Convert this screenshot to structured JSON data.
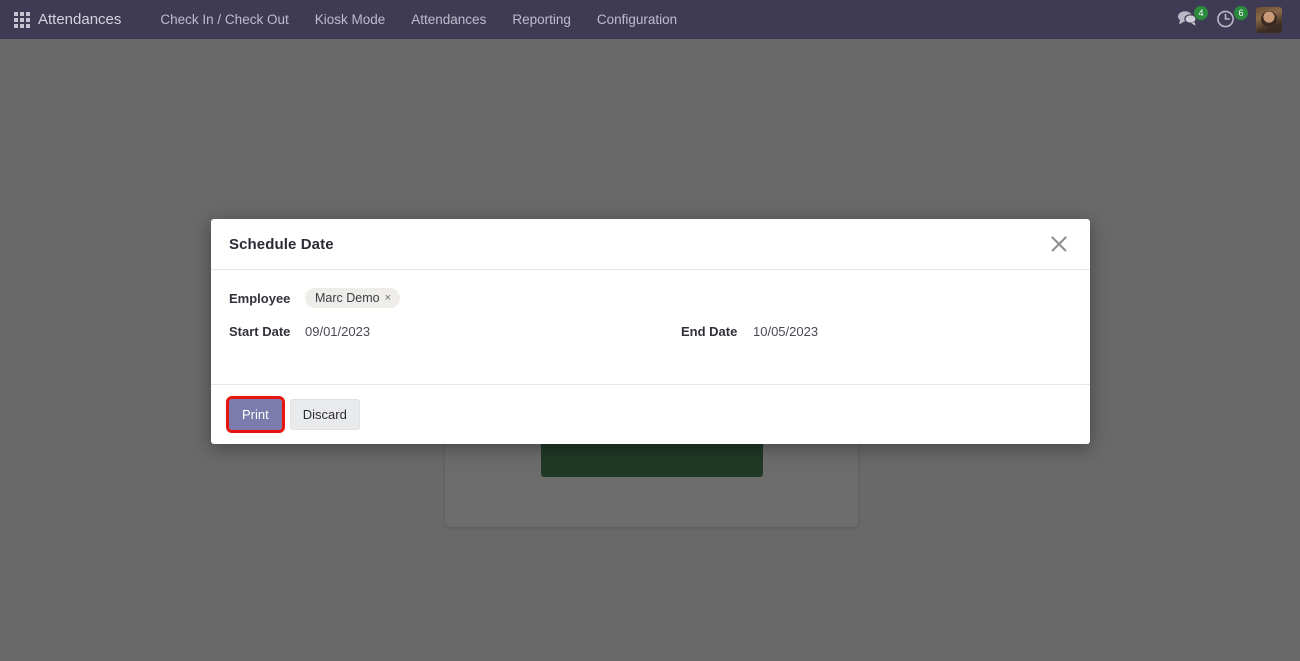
{
  "navbar": {
    "apps_icon": "apps-grid-icon",
    "brand": "Attendances",
    "menu": [
      {
        "label": "Check In / Check Out"
      },
      {
        "label": "Kiosk Mode"
      },
      {
        "label": "Attendances"
      },
      {
        "label": "Reporting"
      },
      {
        "label": "Configuration"
      }
    ],
    "messages_icon": "chat-bubble-icon",
    "messages_count": "4",
    "activities_icon": "clock-icon",
    "activities_count": "6",
    "avatar": "user-avatar"
  },
  "dialog": {
    "title": "Schedule Date",
    "close_icon": "close-icon",
    "employee": {
      "label": "Employee",
      "tag": "Marc Demo",
      "tag_remove_icon": "×"
    },
    "start_date": {
      "label": "Start Date",
      "value": "09/01/2023"
    },
    "end_date": {
      "label": "End Date",
      "value": "10/05/2023"
    },
    "footer": {
      "print_label": "Print",
      "discard_label": "Discard"
    }
  },
  "colors": {
    "navbar_bg": "#3f3b54",
    "primary": "#7c7bad",
    "badge_green": "#2b8a3e",
    "annotation_red": "#e8140f",
    "kiosk_button_green": "#216b32"
  }
}
